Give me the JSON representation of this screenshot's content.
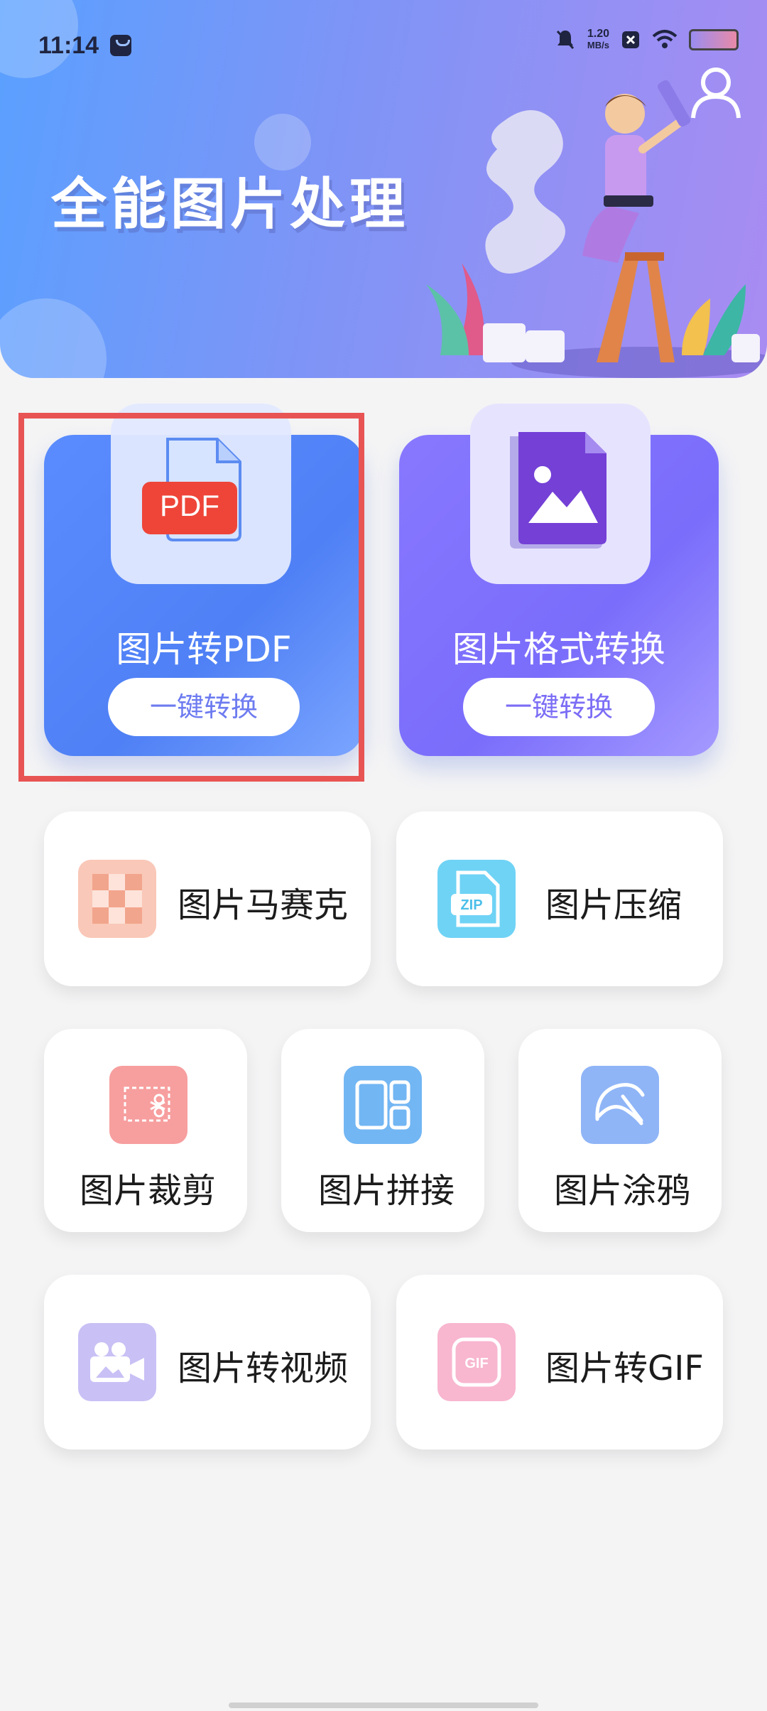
{
  "status_bar": {
    "time": "11:14",
    "net_speed_value": "1.20",
    "net_speed_unit": "MB/s"
  },
  "header": {
    "title": "全能图片处理"
  },
  "features": [
    {
      "label": "图片转PDF",
      "button": "一键转换",
      "icon_text": "PDF",
      "accent": "#5a8cff"
    },
    {
      "label": "图片格式转换",
      "button": "一键转换",
      "accent": "#8878ff"
    }
  ],
  "tools": [
    {
      "label": "图片马赛克",
      "icon": "mosaic-icon",
      "color": "#f9c4b3"
    },
    {
      "label": "图片压缩",
      "icon": "zip-icon",
      "icon_text": "ZIP",
      "color": "#6fd3f5"
    },
    {
      "label": "图片裁剪",
      "icon": "scissors-icon",
      "color": "#f79e9e"
    },
    {
      "label": "图片拼接",
      "icon": "collage-icon",
      "color": "#72b6f3"
    },
    {
      "label": "图片涂鸦",
      "icon": "doodle-icon",
      "color": "#8fb5f7"
    },
    {
      "label": "图片转视频",
      "icon": "video-camera-icon",
      "color": "#c9c0f5"
    },
    {
      "label": "图片转GIF",
      "icon": "gif-icon",
      "icon_text": "GIF",
      "color": "#f8b6cf"
    }
  ]
}
